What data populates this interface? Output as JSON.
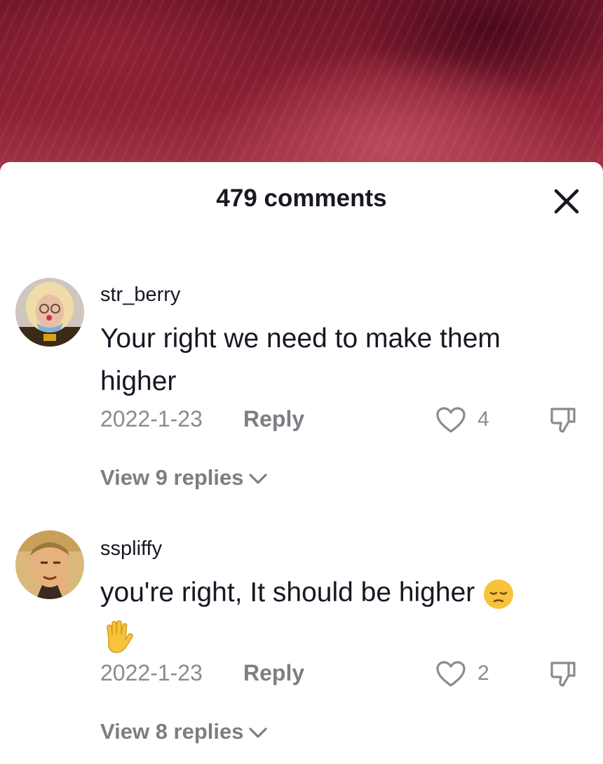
{
  "header": {
    "title": "479 comments"
  },
  "icons": {
    "close": "close-icon",
    "like": "heart-outline-icon",
    "dislike": "thumbs-down-icon",
    "chevron": "chevron-down-icon"
  },
  "comments": [
    {
      "username": "str_berry",
      "text": "Your right we need to make them higher",
      "date": "2022-1-23",
      "reply_label": "Reply",
      "likes": "4",
      "view_replies": "View 9 replies"
    },
    {
      "username": "sspliffy",
      "text": "you're right, It should be higher",
      "emojis": [
        "pensive-face-emoji",
        "raised-hand-emoji"
      ],
      "date": "2022-1-23",
      "reply_label": "Reply",
      "likes": "2",
      "view_replies": "View 8 replies"
    }
  ],
  "colors": {
    "text": "#161823",
    "secondary": "#8a8b91",
    "sheet": "#ffffff",
    "video_bg": "#8a2034"
  }
}
